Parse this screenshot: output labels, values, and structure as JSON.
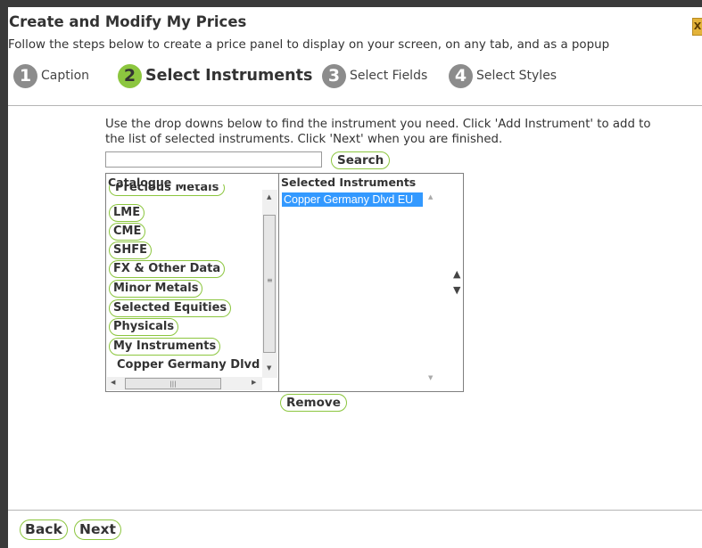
{
  "dialog": {
    "title": "Create and Modify My Prices",
    "subtitle": "Follow the steps below to create a price panel to display on your screen, on any tab, and as a popup",
    "close_label": "X"
  },
  "steps": [
    {
      "number": "1",
      "label": "Caption",
      "active": false
    },
    {
      "number": "2",
      "label": "Select Instruments",
      "active": true
    },
    {
      "number": "3",
      "label": "Select Fields",
      "active": false
    },
    {
      "number": "4",
      "label": "Select Styles",
      "active": false
    }
  ],
  "instructions": "Use the drop downs below to find the instrument you need. Click 'Add Instrument' to add to the list of selected instruments. Click 'Next' when you are finished.",
  "search": {
    "value": "",
    "button_label": "Search"
  },
  "catalogue": {
    "header": "Catalogue",
    "items": [
      "Precious Metals",
      "LME",
      "CME",
      "SHFE",
      "FX & Other Data",
      "Minor Metals",
      "Selected Equities",
      "Physicals",
      "My Instruments"
    ],
    "expanded_item": "Copper Germany Dlvd"
  },
  "selected": {
    "header": "Selected Instruments",
    "items": [
      "Copper Germany Dlvd EU"
    ]
  },
  "buttons": {
    "remove": "Remove",
    "back": "Back",
    "next": "Next"
  },
  "icons": {
    "move_up": "▲",
    "move_down": "▼"
  },
  "colors": {
    "accent_green": "#8cc63f",
    "step_inactive": "#8c8c8c",
    "selection_blue": "#3399ff"
  }
}
